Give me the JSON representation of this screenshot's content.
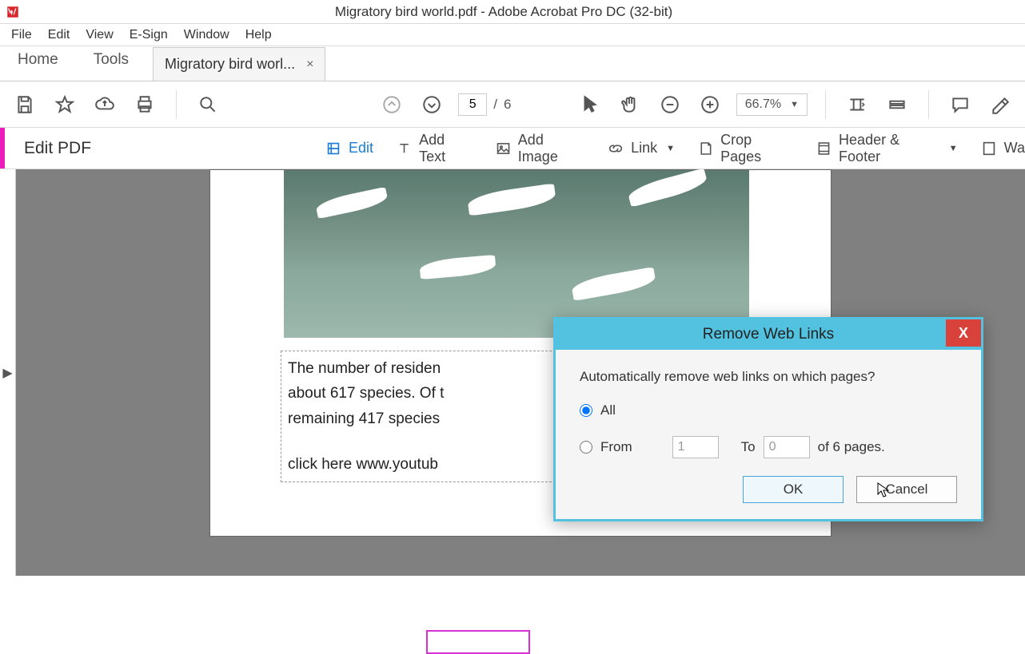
{
  "title": "Migratory bird world.pdf - Adobe Acrobat Pro DC (32-bit)",
  "menu": {
    "file": "File",
    "edit": "Edit",
    "view": "View",
    "esign": "E-Sign",
    "window": "Window",
    "help": "Help"
  },
  "tabs": {
    "home": "Home",
    "tools": "Tools",
    "doc": "Migratory bird worl...",
    "close": "×"
  },
  "page": {
    "current": "5",
    "sep": "/",
    "total": "6"
  },
  "zoom": "66.7%",
  "editpdf": {
    "label": "Edit PDF",
    "edit": "Edit",
    "addtext": "Add Text",
    "addimage": "Add Image",
    "link": "Link",
    "crop": "Crop Pages",
    "header": "Header & Footer",
    "watermark": "Wa"
  },
  "doc_text": {
    "p1": "The number of residen",
    "p2": "about 617 species. Of t",
    "p3": "remaining 417 species",
    "p4a": "click here ",
    "p4b": "www.youtub"
  },
  "dialog": {
    "title": "Remove Web Links",
    "close": "X",
    "question": "Automatically remove web links on which pages?",
    "all": "All",
    "from": "From",
    "from_val": "1",
    "to": "To",
    "to_val": "0",
    "of": "of 6 pages.",
    "ok": "OK",
    "cancel": "Cancel"
  }
}
